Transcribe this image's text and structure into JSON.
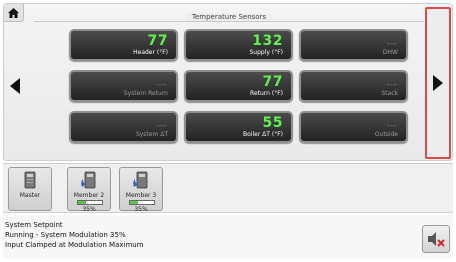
{
  "section": {
    "title": "Temperature Sensors"
  },
  "sensors": [
    {
      "label": "Header (°F)",
      "value": "77"
    },
    {
      "label": "Supply (°F)",
      "value": "132"
    },
    {
      "label": "DHW",
      "value": "---"
    },
    {
      "label": "System Return",
      "value": "---"
    },
    {
      "label": "Return (°F)",
      "value": "77"
    },
    {
      "label": "Stack",
      "value": "---"
    },
    {
      "label": "System ΔT",
      "value": "---"
    },
    {
      "label": "Boiler ΔT (°F)",
      "value": "55"
    },
    {
      "label": "Outside",
      "value": "---"
    }
  ],
  "members": [
    {
      "name": "Master",
      "modulation": "",
      "fill": 0
    },
    {
      "name": "Member 2",
      "modulation": "35%",
      "fill": 0.35
    },
    {
      "name": "Member 3",
      "modulation": "35%",
      "fill": 0.35
    }
  ],
  "status": {
    "line1": "System Setpoint",
    "line2": "Running - System Modulation 35%",
    "line3": "Input Clamped at Modulation Maximum"
  },
  "colors": {
    "value_green": "#5ef24d",
    "highlight_red": "#d64b4b"
  },
  "icons": {
    "home": "home-icon",
    "left": "arrow-left-icon",
    "right": "arrow-right-icon",
    "mute": "speaker-mute-icon",
    "boiler": "boiler-icon"
  }
}
